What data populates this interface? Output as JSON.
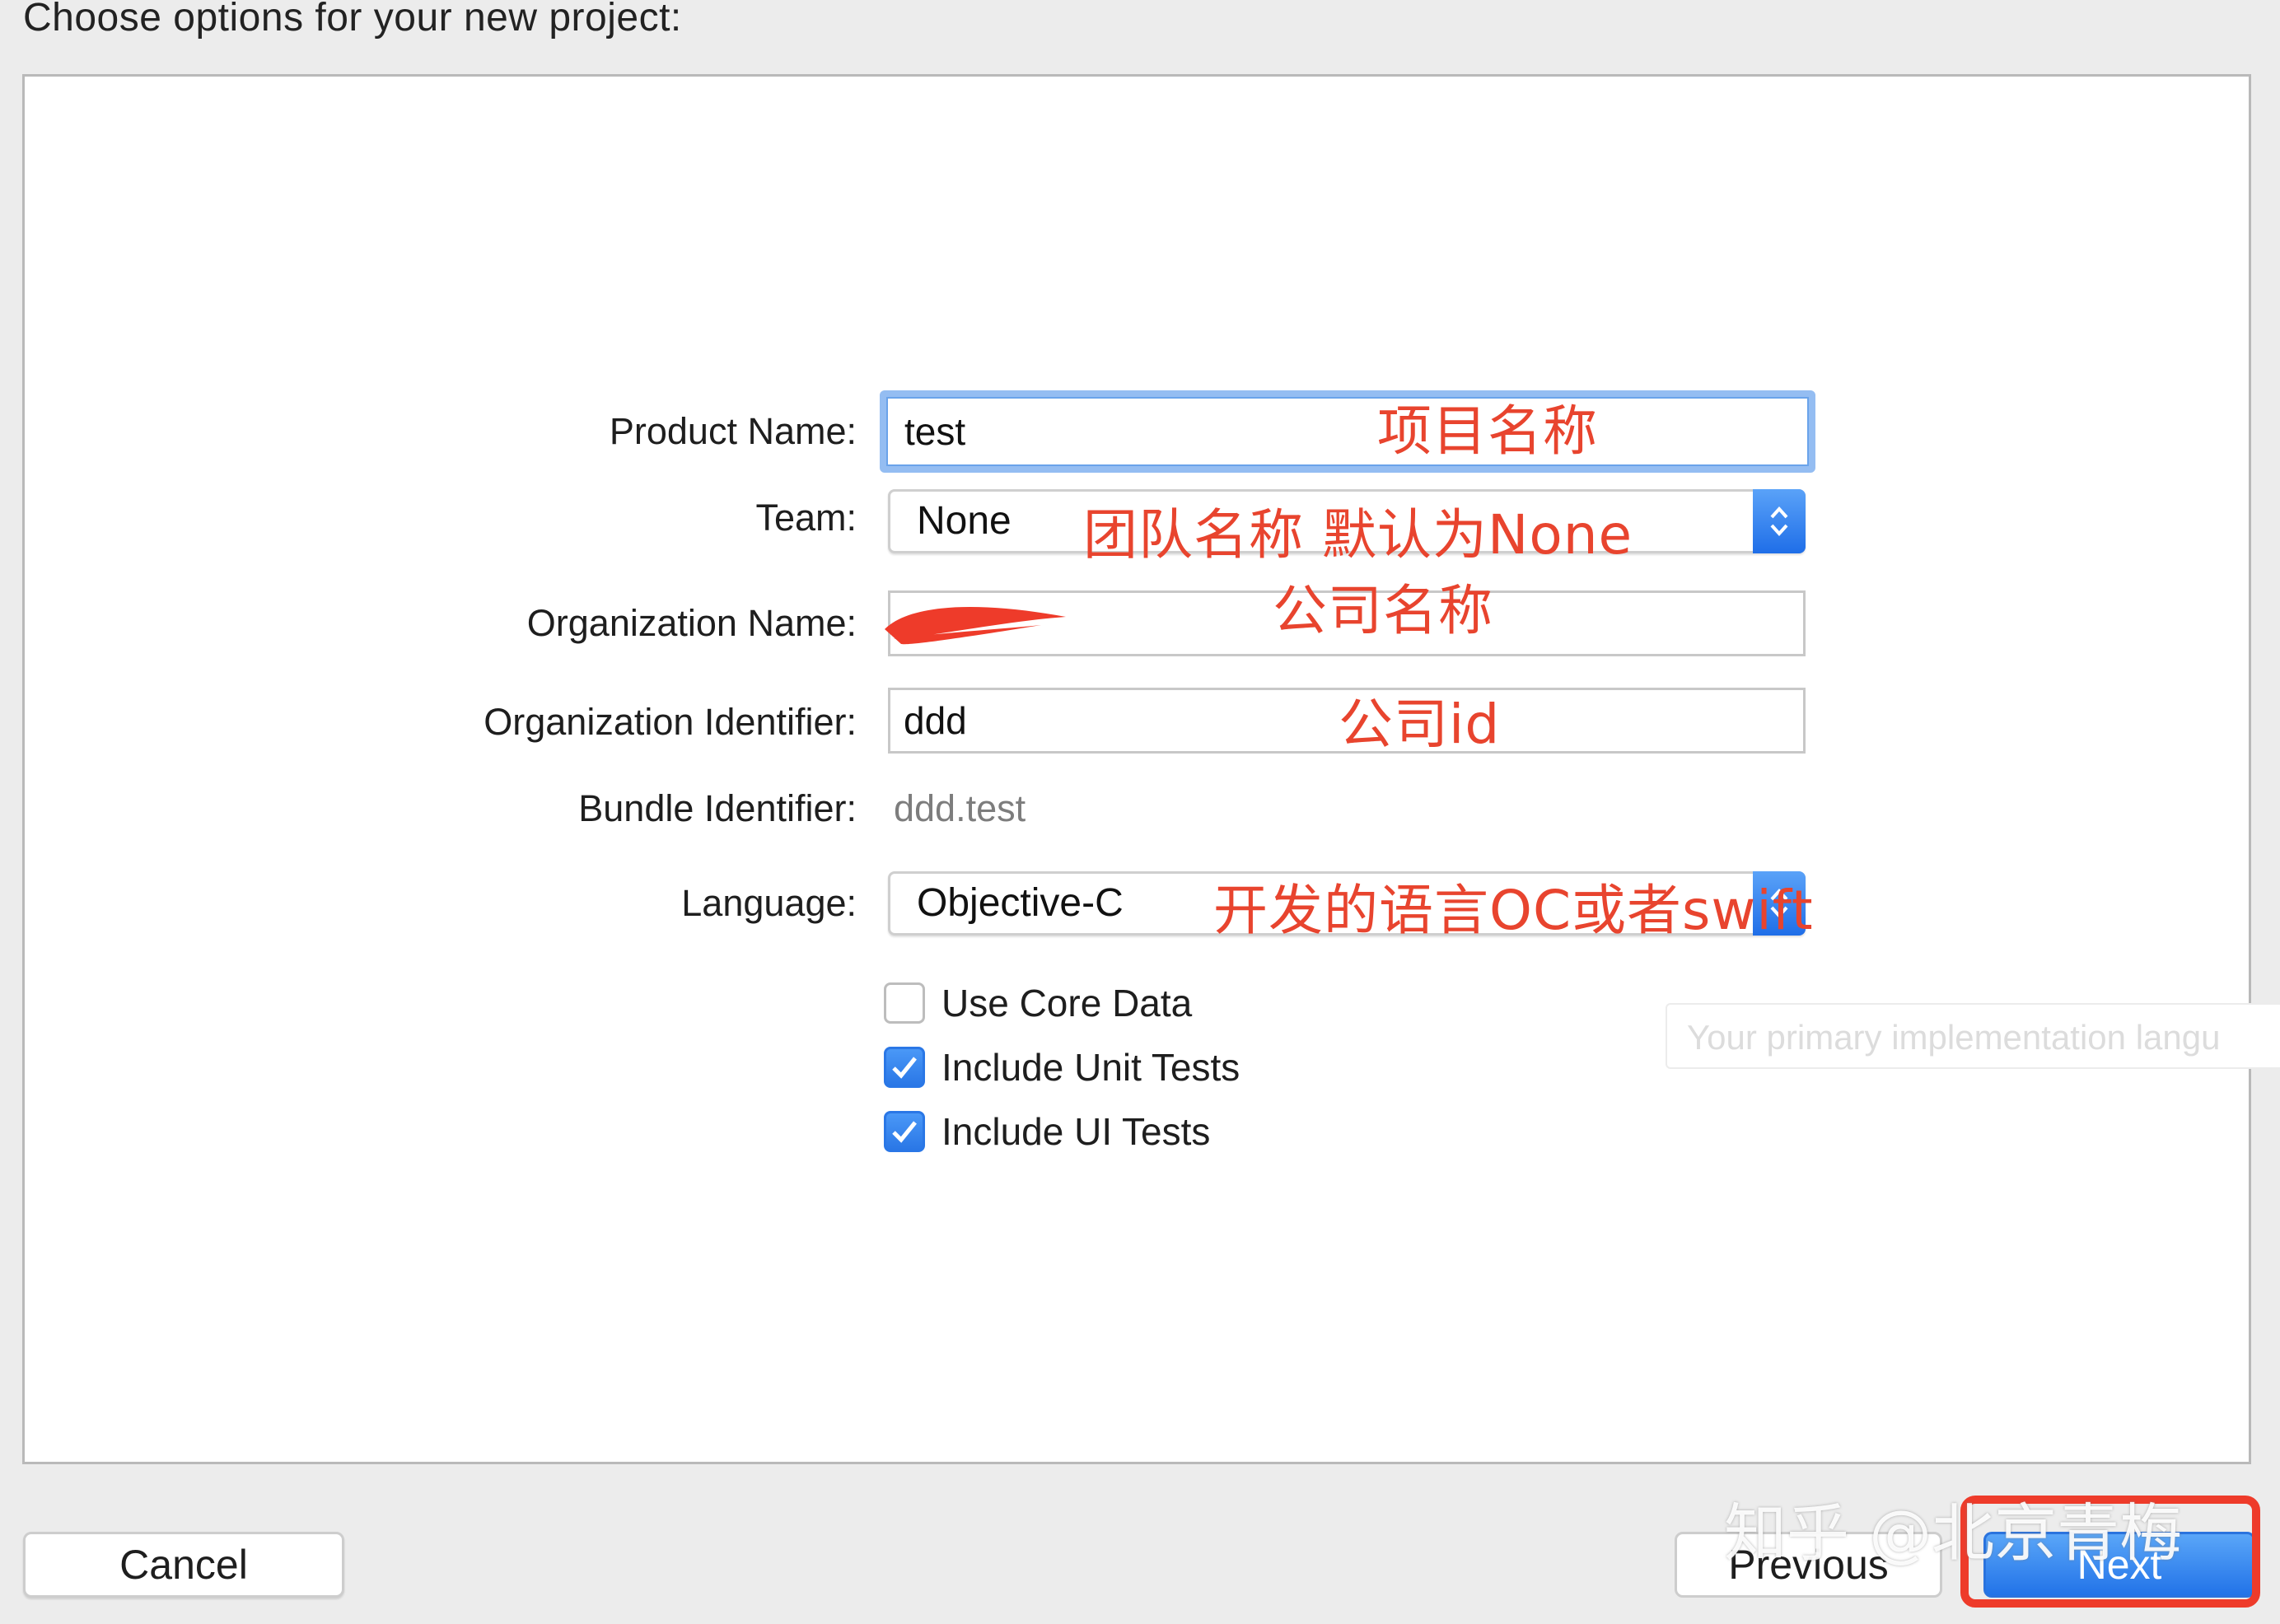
{
  "header": {
    "title": "Choose options for your new project:"
  },
  "form": {
    "product_name": {
      "label": "Product Name:",
      "value": "test"
    },
    "team": {
      "label": "Team:",
      "value": "None"
    },
    "organization_name": {
      "label": "Organization Name:",
      "value": ""
    },
    "organization_identifier": {
      "label": "Organization Identifier:",
      "value": "ddd"
    },
    "bundle_identifier": {
      "label": "Bundle Identifier:",
      "value": "ddd.test"
    },
    "language": {
      "label": "Language:",
      "value": "Objective-C"
    }
  },
  "checkboxes": [
    {
      "label": "Use Core Data",
      "checked": false
    },
    {
      "label": "Include Unit Tests",
      "checked": true
    },
    {
      "label": "Include UI Tests",
      "checked": true
    }
  ],
  "tooltip": {
    "text": "Your primary implementation langu"
  },
  "annotations": {
    "product_name": "项目名称",
    "team": "团队名称 默认为None",
    "organization_name": "公司名称",
    "organization_identifier": "公司id",
    "language": "开发的语言OC或者swift"
  },
  "buttons": {
    "cancel": "Cancel",
    "previous": "Previous",
    "next": "Next"
  },
  "watermark": "知乎 @北京青梅",
  "colors": {
    "accent": "#2a77e6",
    "annotation": "#e8442e",
    "focus_ring": "#94bdf2"
  }
}
